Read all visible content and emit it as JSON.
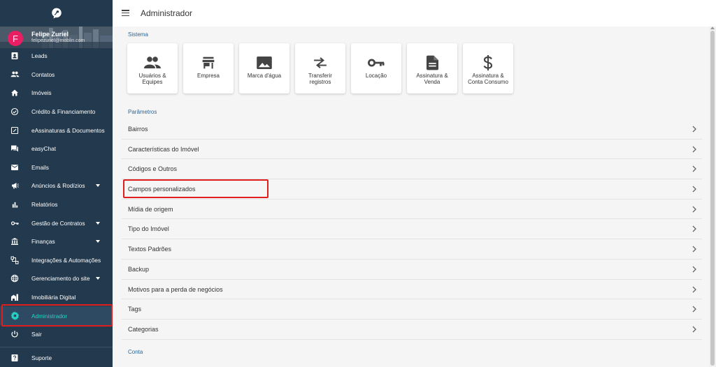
{
  "header": {
    "title": "Administrador"
  },
  "profile": {
    "initial": "F",
    "name": "Felipe Zuriel",
    "email": "felipezuriel@moblin.com"
  },
  "nav": {
    "items": [
      {
        "label": "Leads",
        "icon": "contact-card-icon",
        "caret": false
      },
      {
        "label": "Contatos",
        "icon": "people-icon",
        "caret": false
      },
      {
        "label": "Imóveis",
        "icon": "home-icon",
        "caret": false
      },
      {
        "label": "Crédito & Financiamento",
        "icon": "check-circle-icon",
        "caret": false
      },
      {
        "label": "eAssinaturas & Documentos",
        "icon": "signature-icon",
        "caret": false
      },
      {
        "label": "easyChat",
        "icon": "chat-icon",
        "caret": false
      },
      {
        "label": "Emails",
        "icon": "mail-icon",
        "caret": false
      },
      {
        "label": "Anúncios & Rodízios",
        "icon": "megaphone-icon",
        "caret": true
      },
      {
        "label": "Relatórios",
        "icon": "bar-chart-icon",
        "caret": false
      },
      {
        "label": "Gestão de Contratos",
        "icon": "key-icon",
        "caret": true
      },
      {
        "label": "Finanças",
        "icon": "bank-icon",
        "caret": true
      },
      {
        "label": "Integrações & Automações",
        "icon": "integration-icon",
        "caret": false
      },
      {
        "label": "Gerenciamento do site",
        "icon": "globe-icon",
        "caret": true
      },
      {
        "label": "Imobiliária Digital",
        "icon": "building-icon",
        "caret": false
      },
      {
        "label": "Administrador",
        "icon": "gear-icon",
        "caret": false,
        "active": true
      },
      {
        "label": "Sair",
        "icon": "power-icon",
        "caret": false
      }
    ],
    "support_label": "Suporte"
  },
  "sections": {
    "sistema": "Sistema",
    "parametros": "Parâmetros",
    "conta": "Conta"
  },
  "tiles": [
    {
      "label": "Usuários & Equipes",
      "icon": "people-icon"
    },
    {
      "label": "Empresa",
      "icon": "store-icon"
    },
    {
      "label": "Marca d'água",
      "icon": "image-icon"
    },
    {
      "label": "Transferir registros",
      "icon": "transfer-icon"
    },
    {
      "label": "Locação",
      "icon": "key-icon"
    },
    {
      "label": "Assinatura & Venda",
      "icon": "document-icon"
    },
    {
      "label": "Assinatura & Conta Consumo",
      "icon": "dollar-icon"
    }
  ],
  "params": [
    "Bairros",
    "Características do Imóvel",
    "Códigos e Outros",
    "Campos personalizados",
    "Mídia de origem",
    "Tipo do Imóvel",
    "Textos Padrões",
    "Backup",
    "Motivos para a perda de negócios",
    "Tags",
    "Categorias"
  ],
  "colors": {
    "sidebar": "#23394d",
    "accent": "#20d4c4",
    "highlight": "#e01e1e",
    "avatar": "#e91e63"
  }
}
